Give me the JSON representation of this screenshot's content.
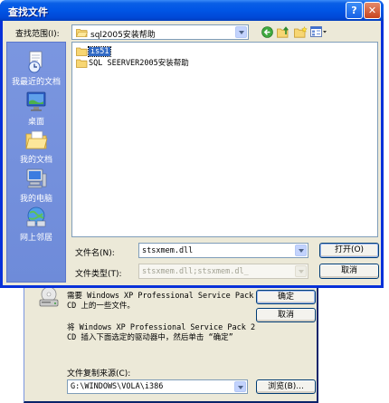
{
  "bg_dialog": {
    "message1_line1": "需要 Windows XP Professional Service Pack 2",
    "message1_line2": "CD 上的一些文件。",
    "message2_line1": "将 Windows XP Professional Service Pack 2",
    "message2_line2": "CD 插入下面选定的驱动器中，然后单击 “确定”",
    "ok_label": "确定",
    "cancel_label": "取消",
    "source_label": "文件复制来源(C):",
    "source_value": "G:\\WINDOWS\\VOLA\\i386",
    "browse_label": "浏览(B)..."
  },
  "dialog": {
    "title": "查找文件",
    "help_glyph": "?",
    "close_glyph": "✕",
    "look_in_label": "查找范围(I):",
    "look_in_value": "sql2005安装帮助",
    "places": [
      {
        "label": "我最近的文档"
      },
      {
        "label": "桌面"
      },
      {
        "label": "我的文档"
      },
      {
        "label": "我的电脑"
      },
      {
        "label": "网上邻居"
      }
    ],
    "files": [
      {
        "name": "is51"
      },
      {
        "name": "SQL SEERVER2005安装帮助"
      }
    ],
    "file_name_label": "文件名(N):",
    "file_name_value": "stsxmem.dll",
    "file_type_label": "文件类型(T):",
    "file_type_value": "stsxmem.dll;stsxmem.dl_",
    "open_label": "打开(O)",
    "cancel_label": "取消"
  },
  "colors": {
    "titlebar": "#0055e5",
    "dialog_bg": "#ece9d8",
    "places_bar": "#7392e2",
    "selection": "#316ac5"
  }
}
